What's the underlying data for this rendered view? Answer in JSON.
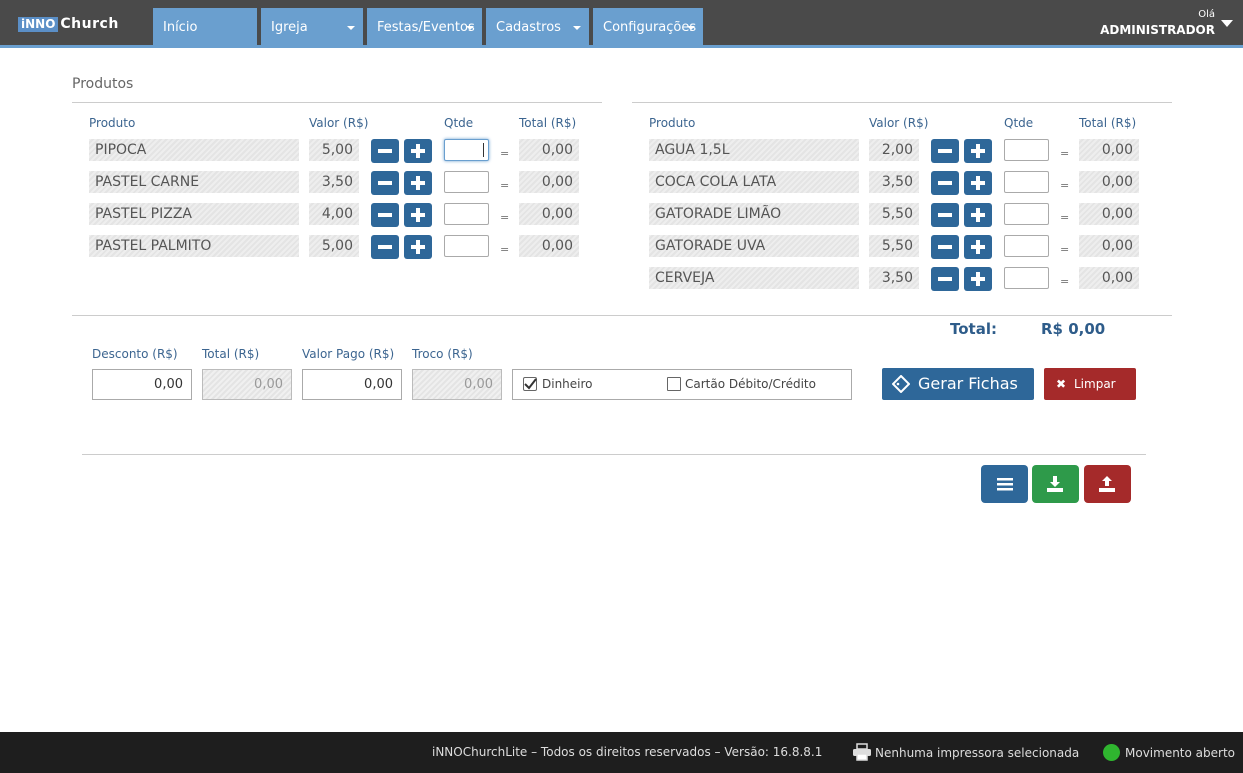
{
  "app": {
    "logo_inno": "iNNO",
    "logo_church": "Church"
  },
  "nav": [
    {
      "label": "Início"
    },
    {
      "label": "Igreja"
    },
    {
      "label": "Festas/Eventos"
    },
    {
      "label": "Cadastros"
    },
    {
      "label": "Configurações"
    }
  ],
  "user": {
    "greeting": "Olá",
    "name": "ADMINISTRADOR"
  },
  "section_title": "Produtos",
  "columns": {
    "produto": "Produto",
    "valor": "Valor (R$)",
    "qtde": "Qtde",
    "total": "Total (R$)"
  },
  "left_products": [
    {
      "name": "PIPOCA",
      "price": "5,00",
      "qty": "",
      "total": "0,00"
    },
    {
      "name": "PASTEL CARNE",
      "price": "3,50",
      "qty": "",
      "total": "0,00"
    },
    {
      "name": "PASTEL PIZZA",
      "price": "4,00",
      "qty": "",
      "total": "0,00"
    },
    {
      "name": "PASTEL PALMITO",
      "price": "5,00",
      "qty": "",
      "total": "0,00"
    }
  ],
  "right_products": [
    {
      "name": "AGUA 1,5L",
      "price": "2,00",
      "qty": "",
      "total": "0,00"
    },
    {
      "name": "COCA COLA LATA",
      "price": "3,50",
      "qty": "",
      "total": "0,00"
    },
    {
      "name": "GATORADE LIMÃO",
      "price": "5,50",
      "qty": "",
      "total": "0,00"
    },
    {
      "name": "GATORADE UVA",
      "price": "5,50",
      "qty": "",
      "total": "0,00"
    },
    {
      "name": "CERVEJA",
      "price": "3,50",
      "qty": "",
      "total": "0,00"
    }
  ],
  "equals_sign": "=",
  "summary": {
    "total_label": "Total:",
    "total_value": "R$ 0,00"
  },
  "payment": {
    "desconto_label": "Desconto (R$)",
    "desconto_value": "0,00",
    "total_label": "Total (R$)",
    "total_value": "0,00",
    "valor_pago_label": "Valor Pago (R$)",
    "valor_pago_value": "0,00",
    "troco_label": "Troco (R$)",
    "troco_value": "0,00",
    "dinheiro_label": "Dinheiro",
    "dinheiro_checked": true,
    "cartao_label": "Cartão Débito/Crédito",
    "cartao_checked": false
  },
  "buttons": {
    "gerar_fichas": "Gerar Fichas",
    "limpar": "Limpar"
  },
  "action_icons": [
    {
      "icon": "list-icon",
      "color": "#2e6799"
    },
    {
      "icon": "download-icon",
      "color": "#2e9a4a"
    },
    {
      "icon": "upload-icon",
      "color": "#a52a2a"
    }
  ],
  "footer": {
    "copyright": "iNNOChurchLite – Todos os direitos reservados – Versão: 16.8.8.1",
    "printer_status": "Nenhuma impressora selecionada",
    "movement_status": "Movimento aberto"
  }
}
